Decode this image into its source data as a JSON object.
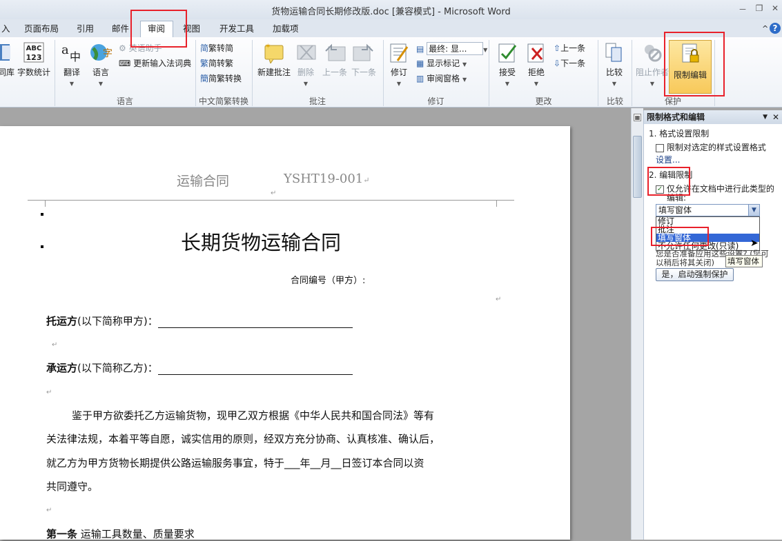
{
  "window": {
    "title": "货物运输合同长期修改版.doc [兼容模式] - Microsoft Word",
    "min": "－",
    "restore": "❐",
    "close": "✕"
  },
  "tabs": {
    "partial": "入",
    "page_layout": "页面布局",
    "references": "引用",
    "mailings": "邮件",
    "review": "审阅",
    "view": "视图",
    "developer": "开发工具",
    "addins": "加载项",
    "collapse": "^",
    "help": "?"
  },
  "ribbon": {
    "thesaurus": "同库",
    "word_count": "字数统计",
    "translate": "翻译",
    "language": "语言",
    "translate_helper": "英语助手",
    "update_ime": "更新输入法词典",
    "group_language": "语言",
    "trad_to_simp": "繁转简",
    "simp_to_trad": "简转繁",
    "simp_trad_convert": "简繁转换",
    "group_chinese": "中文简繁转换",
    "new_comment": "新建批注",
    "delete": "删除",
    "previous": "上一条",
    "next": "下一条",
    "group_comments": "批注",
    "track_changes": "修订",
    "final_show": "最终: 显...",
    "show_markup": "显示标记",
    "review_pane": "审阅窗格",
    "group_tracking": "修订",
    "accept": "接受",
    "reject": "拒绝",
    "prev_change": "上一条",
    "next_change": "下一条",
    "group_changes": "更改",
    "compare": "比较",
    "group_compare": "比较",
    "block_authors": "阻止作者",
    "restrict_editing": "限制编辑",
    "group_protect": "保护"
  },
  "document": {
    "header_left": "运输合同",
    "header_right": "YSHT19-001",
    "title": "长期货物运输合同",
    "contract_no": "合同编号（甲方）:",
    "shipper_label": "托运方",
    "shipper_rest": "(以下简称甲方)：",
    "carrier_label": "承运方",
    "carrier_rest": "(以下简称乙方)：",
    "para1_line1": "鉴于甲方欲委托乙方运输货物，现甲乙双方根据《中华人民共和国合同法》等有",
    "para1_line2": "关法律法规，本着平等自愿，诚实信用的原则，经双方充分协商、认真核准、确认后，",
    "para1_line3": "就乙方为甲方货物长期提供公路运输服务事宜，特于___年__月__日签订本合同以资",
    "para1_line4": "共同遵守。",
    "article1_label": "第一条",
    "article1_rest": "运输工具数量、质量要求"
  },
  "pane": {
    "title": "限制格式和编辑",
    "sec1": "1. 格式设置限制",
    "sec1_check": "限制对选定的样式设置格式",
    "sec1_link": "设置...",
    "sec2": "2. 编辑限制",
    "sec2_check_line1": "仅允许在文档中进行此类型的",
    "sec2_check_line2": "编辑:",
    "dropdown_value": "填写窗体",
    "options": [
      "修订",
      "批注",
      "填写窗体",
      "不允许任何更改(只读)"
    ],
    "obscured_line1": "您是否准备应用这些设置? (您可",
    "obscured_line2": "以稍后将其关闭)",
    "tooltip": "填写窗体",
    "start_button": "是，启动强制保护"
  },
  "colors": {
    "highlight": "#e8202a",
    "selection": "#3367d6"
  }
}
